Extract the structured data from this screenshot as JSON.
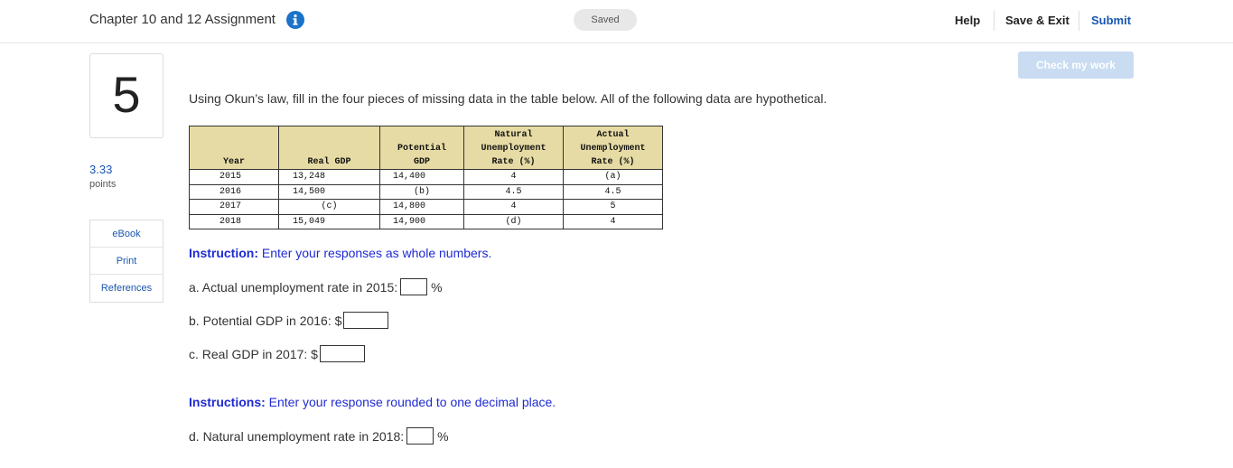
{
  "header": {
    "assignment_title": "Chapter 10 and 12 Assignment",
    "info_icon": "info-icon",
    "saved_status": "Saved",
    "help_label": "Help",
    "save_exit_label": "Save & Exit",
    "submit_label": "Submit"
  },
  "question": {
    "number": "5",
    "points_value": "3.33",
    "points_label": "points",
    "prompt": "Using Okun’s law, fill in the four pieces of missing data in the table below. All of the following data are hypothetical."
  },
  "side_nav": [
    "eBook",
    "Print",
    "References"
  ],
  "check_my_work_label": "Check my work",
  "table": {
    "headers": [
      [
        "Year"
      ],
      [
        "Real GDP"
      ],
      [
        "Potential",
        "GDP"
      ],
      [
        "Natural",
        "Unemployment",
        "Rate (%)"
      ],
      [
        "Actual",
        "Unemployment",
        "Rate (%)"
      ]
    ],
    "rows": [
      [
        "2015",
        "13,248",
        "14,400",
        "4",
        "(a)"
      ],
      [
        "2016",
        "14,500",
        "(b)",
        "4.5",
        "4.5"
      ],
      [
        "2017",
        "(c)",
        "14,800",
        "4",
        "5"
      ],
      [
        "2018",
        "15,049",
        "14,900",
        "(d)",
        "4"
      ]
    ]
  },
  "instruction1": {
    "bold": "Instruction:",
    "text": " Enter your responses as whole numbers."
  },
  "questions": {
    "a": {
      "label": "a. Actual unemployment rate in 2015:",
      "unit": "%",
      "value": ""
    },
    "b": {
      "label": "b. Potential GDP in 2016: $",
      "value": ""
    },
    "c": {
      "label": "c. Real GDP in 2017: $",
      "value": ""
    },
    "d": {
      "label": "d. Natural unemployment rate in 2018:",
      "unit": "%",
      "value": ""
    }
  },
  "instruction2": {
    "bold": "Instructions:",
    "text": " Enter your response rounded to one decimal place."
  },
  "colors": {
    "accent_blue": "#1a56b0",
    "instruction_blue": "#1f2bd1",
    "table_header_bg": "#e6dba4",
    "check_btn_bg": "#c9dcf2"
  }
}
